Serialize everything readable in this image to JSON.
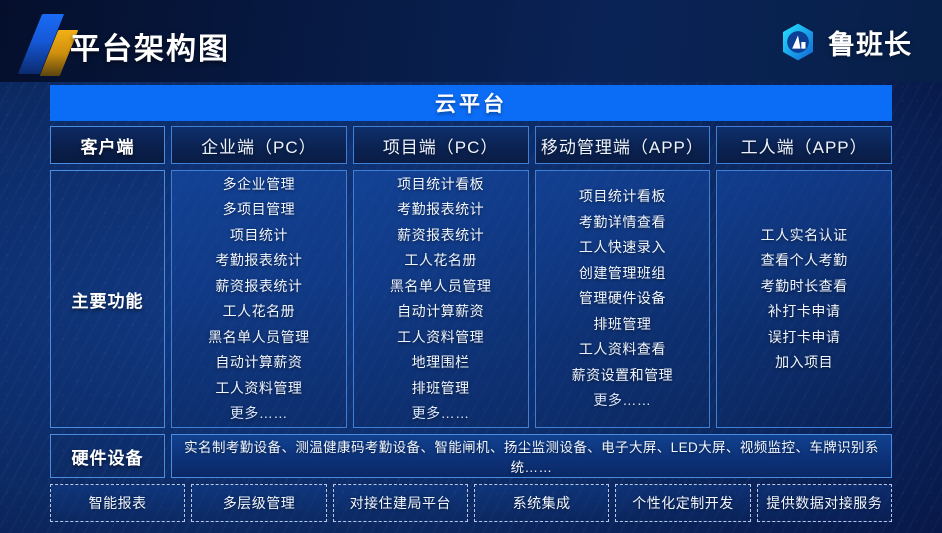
{
  "header": {
    "title": "平台架构图",
    "brand_name": "鲁班长",
    "brand_icon": "building-hexagon-logo-icon",
    "accent_icon": "slash-accent-icon"
  },
  "cloud_banner": {
    "label": "云平台"
  },
  "side_labels": {
    "client": "客户端",
    "main_functions": "主要功能",
    "hardware": "硬件设备"
  },
  "columns": [
    {
      "header": "企业端（PC）",
      "items": [
        "多企业管理",
        "多项目管理",
        "项目统计",
        "考勤报表统计",
        "薪资报表统计",
        "工人花名册",
        "黑名单人员管理",
        "自动计算薪资",
        "工人资料管理",
        "更多……"
      ]
    },
    {
      "header": "项目端（PC）",
      "items": [
        "项目统计看板",
        "考勤报表统计",
        "薪资报表统计",
        "工人花名册",
        "黑名单人员管理",
        "自动计算薪资",
        "工人资料管理",
        "地理围栏",
        "排班管理",
        "更多……"
      ]
    },
    {
      "header": "移动管理端（APP）",
      "items": [
        "项目统计看板",
        "考勤详情查看",
        "工人快速录入",
        "创建管理班组",
        "管理硬件设备",
        "排班管理",
        "工人资料查看",
        "薪资设置和管理",
        "更多……"
      ]
    },
    {
      "header": "工人端（APP）",
      "items": [
        "工人实名认证",
        "查看个人考勤",
        "考勤时长查看",
        "补打卡申请",
        "误打卡申请",
        "加入项目"
      ]
    }
  ],
  "hardware_description": "实名制考勤设备、测温健康码考勤设备、智能闸机、扬尘监测设备、电子大屏、LED大屏、视频监控、车牌识别系统……",
  "services": [
    "智能报表",
    "多层级管理",
    "对接住建局平台",
    "系统集成",
    "个性化定制开发",
    "提供数据对接服务"
  ],
  "colors": {
    "page_bg": "#0c2a64",
    "header_bg": "#071b46",
    "cloud_blue": "#0b6cf5",
    "border_blue": "#3f7fd6",
    "accent_gold": "#f2b117",
    "text_white": "#ffffff"
  }
}
